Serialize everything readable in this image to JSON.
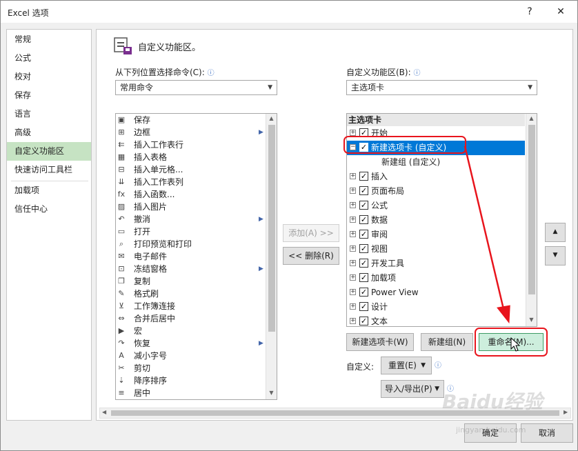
{
  "window": {
    "title": "Excel 选项",
    "help": "?",
    "close": "✕"
  },
  "sidebar": {
    "items": [
      {
        "label": "常规"
      },
      {
        "label": "公式"
      },
      {
        "label": "校对"
      },
      {
        "label": "保存"
      },
      {
        "label": "语言"
      },
      {
        "label": "高级"
      },
      {
        "label": "自定义功能区"
      },
      {
        "label": "快速访问工具栏"
      },
      {
        "label": "加载项"
      },
      {
        "label": "信任中心"
      }
    ],
    "selected": "自定义功能区"
  },
  "main": {
    "heading": "自定义功能区。",
    "left_label": "从下列位置选择命令(C):",
    "left_combo": "常用命令",
    "right_label": "自定义功能区(B):",
    "right_combo": "主选项卡",
    "commands": [
      {
        "icon": "save-icon",
        "glyph": "▣",
        "label": "保存"
      },
      {
        "icon": "border-icon",
        "glyph": "⊞",
        "label": "边框",
        "sub": true
      },
      {
        "icon": "insert-row-icon",
        "glyph": "⇇",
        "label": "插入工作表行"
      },
      {
        "icon": "table-icon",
        "glyph": "▦",
        "label": "插入表格"
      },
      {
        "icon": "insert-cell-icon",
        "glyph": "⊟",
        "label": "插入单元格..."
      },
      {
        "icon": "insert-column-icon",
        "glyph": "⇊",
        "label": "插入工作表列"
      },
      {
        "icon": "function-icon",
        "glyph": "fx",
        "label": "插入函数..."
      },
      {
        "icon": "picture-icon",
        "glyph": "▨",
        "label": "插入图片"
      },
      {
        "icon": "undo-icon",
        "glyph": "↶",
        "label": "撤消",
        "sub": true
      },
      {
        "icon": "folder-icon",
        "glyph": "▭",
        "label": "打开"
      },
      {
        "icon": "print-preview-icon",
        "glyph": "⌕",
        "label": "打印预览和打印"
      },
      {
        "icon": "mail-icon",
        "glyph": "✉",
        "label": "电子邮件"
      },
      {
        "icon": "freeze-pane-icon",
        "glyph": "⊡",
        "label": "冻结窗格",
        "sub": true
      },
      {
        "icon": "copy-icon",
        "glyph": "❐",
        "label": "复制"
      },
      {
        "icon": "format-painter-icon",
        "glyph": "✎",
        "label": "格式刷"
      },
      {
        "icon": "filter-icon",
        "glyph": "⊻",
        "label": "工作簿连接"
      },
      {
        "icon": "merge-center-icon",
        "glyph": "⇔",
        "label": "合并后居中"
      },
      {
        "icon": "macro-icon",
        "glyph": "▶",
        "label": "宏"
      },
      {
        "icon": "redo-icon",
        "glyph": "↷",
        "label": "恢复",
        "sub": true
      },
      {
        "icon": "font-decrease-icon",
        "glyph": "A",
        "label": "减小字号"
      },
      {
        "icon": "cut-icon",
        "glyph": "✂",
        "label": "剪切"
      },
      {
        "icon": "sort-desc-icon",
        "glyph": "⇣",
        "label": "降序排序"
      },
      {
        "icon": "align-center-icon",
        "glyph": "≡",
        "label": "居中"
      }
    ],
    "add_button": "添加(A) >>",
    "remove_button": "<< 删除(R)",
    "tree_header": "主选项卡",
    "tree": [
      {
        "label": "开始",
        "expander": "+",
        "checked": true
      },
      {
        "label": "新建选项卡 (自定义)",
        "expander": "−",
        "checked": true,
        "selected": true
      },
      {
        "label": "新建组 (自定义)",
        "child": true
      },
      {
        "label": "插入",
        "expander": "+",
        "checked": true
      },
      {
        "label": "页面布局",
        "expander": "+",
        "checked": true
      },
      {
        "label": "公式",
        "expander": "+",
        "checked": true
      },
      {
        "label": "数据",
        "expander": "+",
        "checked": true
      },
      {
        "label": "审阅",
        "expander": "+",
        "checked": true
      },
      {
        "label": "视图",
        "expander": "+",
        "checked": true
      },
      {
        "label": "开发工具",
        "expander": "+",
        "checked": true
      },
      {
        "label": "加载项",
        "expander": "+",
        "checked": true
      },
      {
        "label": "Power View",
        "expander": "+",
        "checked": true
      },
      {
        "label": "设计",
        "expander": "+",
        "checked": true
      },
      {
        "label": "文本",
        "expander": "+",
        "checked": true
      }
    ],
    "new_tab_button": "新建选项卡(W)",
    "new_group_button": "新建组(N)",
    "rename_button": "重命名(M)...",
    "customize_label": "自定义:",
    "reset_button": "重置(E)",
    "import_export_button": "导入/导出(P)"
  },
  "footer": {
    "ok": "确定",
    "cancel": "取消"
  },
  "watermark": {
    "text": "Baidu经验",
    "url": "jingyan.baidu.com"
  }
}
